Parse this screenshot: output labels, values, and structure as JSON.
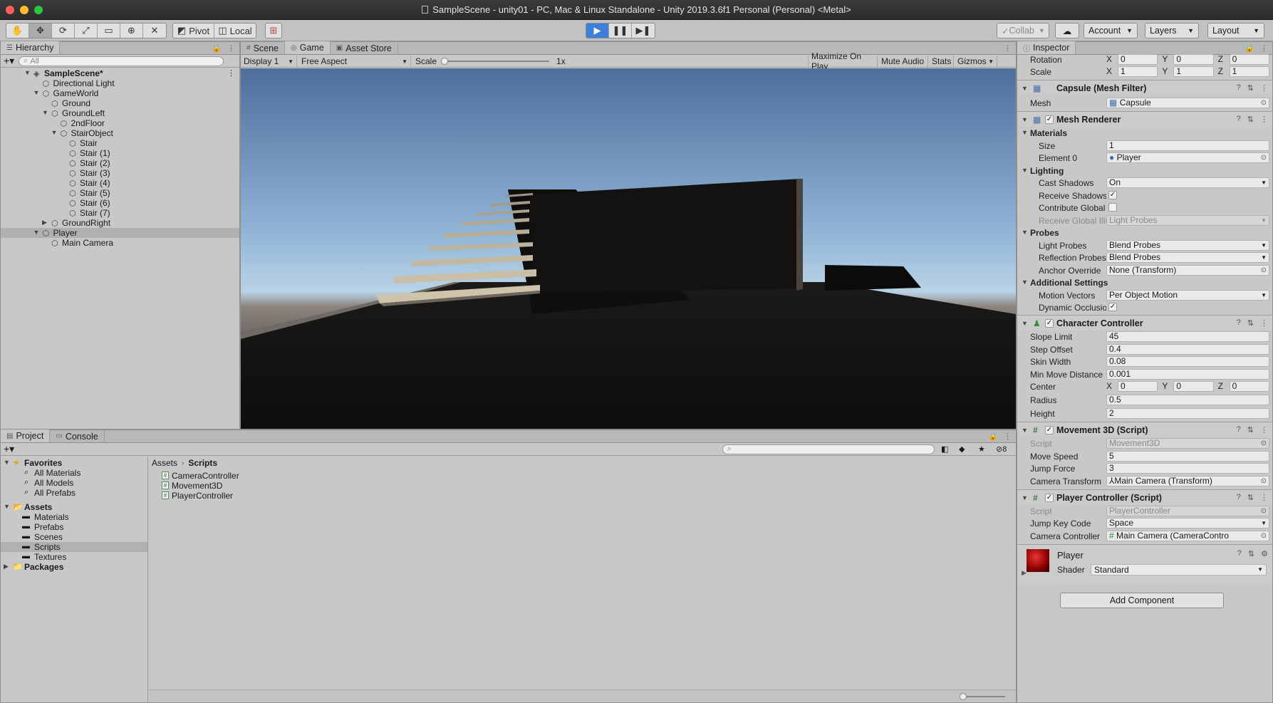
{
  "window": {
    "title": "SampleScene - unity01 - PC, Mac & Linux Standalone - Unity 2019.3.6f1 Personal (Personal) <Metal>"
  },
  "toolbar": {
    "pivot": "Pivot",
    "local": "Local",
    "collab": "Collab",
    "account": "Account",
    "layers": "Layers",
    "layout": "Layout"
  },
  "hierarchy": {
    "tab": "Hierarchy",
    "search_placeholder": "All",
    "items": [
      {
        "label": "SampleScene*",
        "depth": 0,
        "expand": "open",
        "kind": "scene"
      },
      {
        "label": "Directional Light",
        "depth": 1,
        "expand": "none",
        "kind": "obj"
      },
      {
        "label": "GameWorld",
        "depth": 1,
        "expand": "open",
        "kind": "obj"
      },
      {
        "label": "Ground",
        "depth": 2,
        "expand": "none",
        "kind": "obj"
      },
      {
        "label": "GroundLeft",
        "depth": 2,
        "expand": "open",
        "kind": "obj"
      },
      {
        "label": "2ndFloor",
        "depth": 3,
        "expand": "none",
        "kind": "obj"
      },
      {
        "label": "StairObject",
        "depth": 3,
        "expand": "open",
        "kind": "obj"
      },
      {
        "label": "Stair",
        "depth": 4,
        "expand": "none",
        "kind": "obj"
      },
      {
        "label": "Stair (1)",
        "depth": 4,
        "expand": "none",
        "kind": "obj"
      },
      {
        "label": "Stair (2)",
        "depth": 4,
        "expand": "none",
        "kind": "obj"
      },
      {
        "label": "Stair (3)",
        "depth": 4,
        "expand": "none",
        "kind": "obj"
      },
      {
        "label": "Stair (4)",
        "depth": 4,
        "expand": "none",
        "kind": "obj"
      },
      {
        "label": "Stair (5)",
        "depth": 4,
        "expand": "none",
        "kind": "obj"
      },
      {
        "label": "Stair (6)",
        "depth": 4,
        "expand": "none",
        "kind": "obj"
      },
      {
        "label": "Stair (7)",
        "depth": 4,
        "expand": "none",
        "kind": "obj"
      },
      {
        "label": "GroundRight",
        "depth": 2,
        "expand": "closed",
        "kind": "obj"
      },
      {
        "label": "Player",
        "depth": 1,
        "expand": "open",
        "kind": "obj",
        "selected": true
      },
      {
        "label": "Main Camera",
        "depth": 2,
        "expand": "none",
        "kind": "obj"
      }
    ]
  },
  "view": {
    "tabs": [
      "Scene",
      "Game",
      "Asset Store"
    ],
    "active_tab": "Game",
    "display": "Display 1",
    "aspect": "Free Aspect",
    "scale_label": "Scale",
    "scale_value": "1x",
    "maximize": "Maximize On Play",
    "mute": "Mute Audio",
    "stats": "Stats",
    "gizmos": "Gizmos"
  },
  "project": {
    "tabs": [
      "Project",
      "Console"
    ],
    "active_tab": "Project",
    "hidden_count": "8",
    "favorites": {
      "label": "Favorites",
      "items": [
        "All Materials",
        "All Models",
        "All Prefabs"
      ]
    },
    "assets": {
      "label": "Assets",
      "items": [
        "Materials",
        "Prefabs",
        "Scenes",
        "Scripts",
        "Textures"
      ],
      "selected": "Scripts"
    },
    "packages": "Packages",
    "breadcrumb": [
      "Assets",
      "Scripts"
    ],
    "files": [
      "CameraController",
      "Movement3D",
      "PlayerController"
    ]
  },
  "inspector": {
    "tab": "Inspector",
    "transform": {
      "rotation": {
        "label": "Rotation",
        "x": "0",
        "y": "0",
        "z": "0"
      },
      "scale": {
        "label": "Scale",
        "x": "1",
        "y": "1",
        "z": "1"
      }
    },
    "mesh_filter": {
      "title": "Capsule (Mesh Filter)",
      "mesh_label": "Mesh",
      "mesh": "Capsule"
    },
    "mesh_renderer": {
      "title": "Mesh Renderer",
      "materials": "Materials",
      "size_label": "Size",
      "size": "1",
      "element0_label": "Element 0",
      "element0": "Player",
      "lighting": "Lighting",
      "cast_shadows_label": "Cast Shadows",
      "cast_shadows": "On",
      "receive_shadows_label": "Receive Shadows",
      "contribute_gi_label": "Contribute Global Il",
      "receive_gi_label": "Receive Global Illu",
      "receive_gi": "Light Probes",
      "probes": "Probes",
      "light_probes_label": "Light Probes",
      "light_probes": "Blend Probes",
      "reflection_probes_label": "Reflection Probes",
      "reflection_probes": "Blend Probes",
      "anchor_override_label": "Anchor Override",
      "anchor_override": "None (Transform)",
      "additional": "Additional Settings",
      "motion_vectors_label": "Motion Vectors",
      "motion_vectors": "Per Object Motion",
      "dynamic_occlusion_label": "Dynamic Occlusior"
    },
    "character_controller": {
      "title": "Character Controller",
      "slope_label": "Slope Limit",
      "slope": "45",
      "step_label": "Step Offset",
      "step": "0.4",
      "skin_label": "Skin Width",
      "skin": "0.08",
      "minmove_label": "Min Move Distance",
      "minmove": "0.001",
      "center_label": "Center",
      "cx": "0",
      "cy": "0",
      "cz": "0",
      "radius_label": "Radius",
      "radius": "0.5",
      "height_label": "Height",
      "height": "2"
    },
    "movement3d": {
      "title": "Movement 3D (Script)",
      "script_label": "Script",
      "script": "Movement3D",
      "move_speed_label": "Move Speed",
      "move_speed": "5",
      "jump_force_label": "Jump Force",
      "jump_force": "3",
      "camera_transform_label": "Camera Transform",
      "camera_transform": "Main Camera (Transform)"
    },
    "player_controller": {
      "title": "Player Controller (Script)",
      "script_label": "Script",
      "script": "PlayerController",
      "jump_key_label": "Jump Key Code",
      "jump_key": "Space",
      "camera_controller_label": "Camera Controller",
      "camera_controller": "Main Camera (CameraContro"
    },
    "material": {
      "name": "Player",
      "shader_label": "Shader",
      "shader": "Standard"
    },
    "add_component": "Add Component"
  },
  "colors": {
    "play_accent": "#3f7fdc",
    "material_red": "#b01010"
  }
}
